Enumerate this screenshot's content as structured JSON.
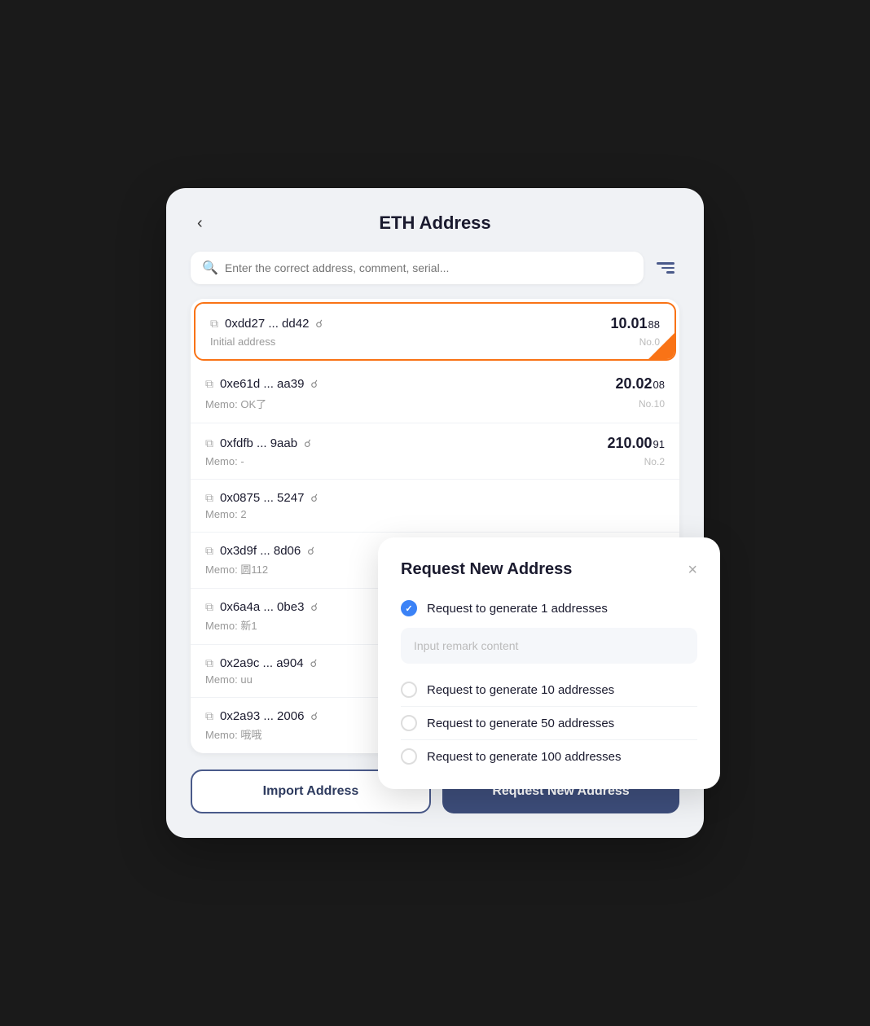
{
  "header": {
    "title": "ETH Address",
    "back_label": "‹"
  },
  "search": {
    "placeholder": "Enter the correct address, comment, serial...",
    "value": ""
  },
  "addresses": [
    {
      "id": 0,
      "address": "0xdd27 ... dd42",
      "memo": "Initial address",
      "balance_main": "10.01",
      "balance_small": "88",
      "no": "No.0",
      "active": true
    },
    {
      "id": 1,
      "address": "0xe61d ... aa39",
      "memo": "Memo: OK了",
      "balance_main": "20.02",
      "balance_small": "08",
      "no": "No.10",
      "active": false
    },
    {
      "id": 2,
      "address": "0xfdfb ... 9aab",
      "memo": "Memo: -",
      "balance_main": "210.00",
      "balance_small": "91",
      "no": "No.2",
      "active": false
    },
    {
      "id": 3,
      "address": "0x0875 ... 5247",
      "memo": "Memo: 2",
      "balance_main": "",
      "balance_small": "",
      "no": "",
      "active": false
    },
    {
      "id": 4,
      "address": "0x3d9f ... 8d06",
      "memo": "Memo: 圆112",
      "balance_main": "",
      "balance_small": "",
      "no": "",
      "active": false
    },
    {
      "id": 5,
      "address": "0x6a4a ... 0be3",
      "memo": "Memo: 新1",
      "balance_main": "",
      "balance_small": "",
      "no": "",
      "active": false
    },
    {
      "id": 6,
      "address": "0x2a9c ... a904",
      "memo": "Memo: uu",
      "balance_main": "",
      "balance_small": "",
      "no": "",
      "active": false
    },
    {
      "id": 7,
      "address": "0x2a93 ... 2006",
      "memo": "Memo: 哦哦",
      "balance_main": "",
      "balance_small": "",
      "no": "",
      "active": false
    }
  ],
  "buttons": {
    "import": "Import Address",
    "request": "Request New Address"
  },
  "modal": {
    "title": "Request New Address",
    "close_label": "×",
    "remark_placeholder": "Input remark content",
    "options": [
      {
        "label": "Request to generate 1 addresses",
        "checked": true
      },
      {
        "label": "Request to generate 10 addresses",
        "checked": false
      },
      {
        "label": "Request to generate 50 addresses",
        "checked": false
      },
      {
        "label": "Request to generate 100 addresses",
        "checked": false
      }
    ]
  }
}
